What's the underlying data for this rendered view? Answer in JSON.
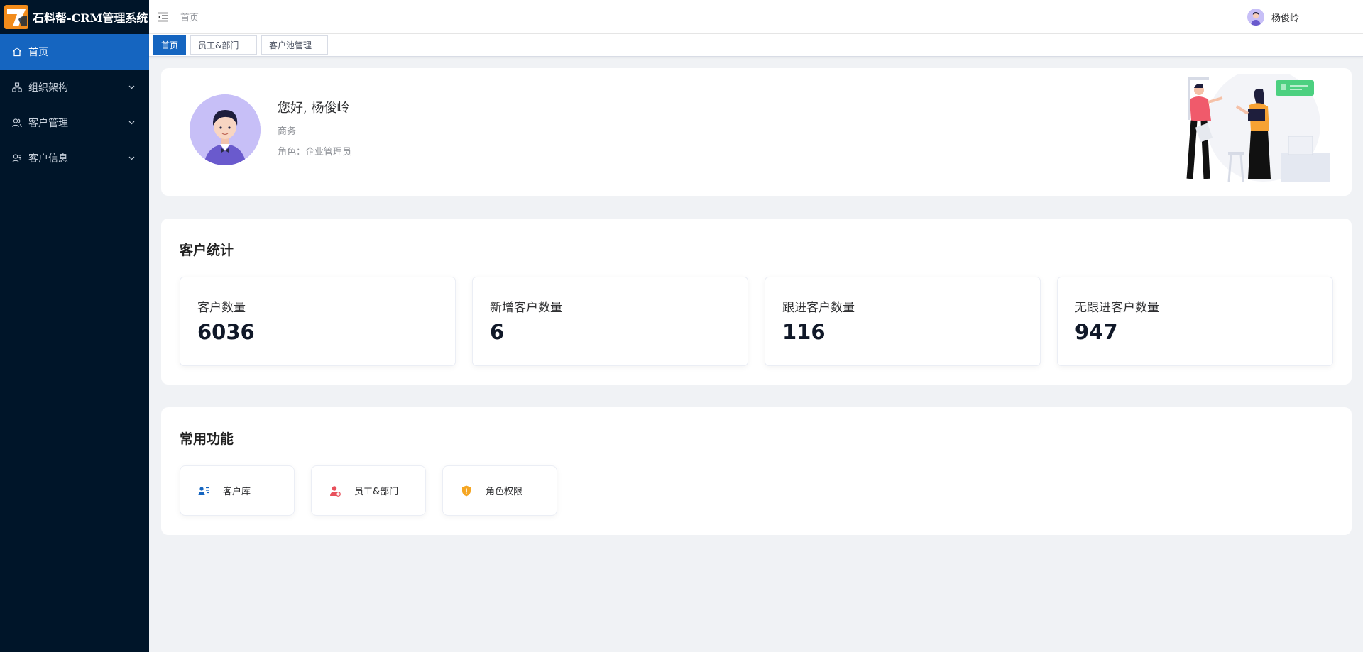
{
  "app": {
    "title": "石料帮-CRM管理系统"
  },
  "sidebar": {
    "items": [
      {
        "label": "首页",
        "icon": "home-icon",
        "active": true
      },
      {
        "label": "组织架构",
        "icon": "org-icon"
      },
      {
        "label": "客户管理",
        "icon": "users-icon"
      },
      {
        "label": "客户信息",
        "icon": "user-info-icon"
      }
    ]
  },
  "header": {
    "breadcrumb": "首页",
    "user_name": "杨俊岭"
  },
  "tabs": [
    {
      "label": "首页",
      "active": true
    },
    {
      "label": "员工&部门"
    },
    {
      "label": "客户池管理"
    }
  ],
  "welcome": {
    "greeting": "您好, 杨俊岭",
    "dept": "商务",
    "role": "角色：企业管理员"
  },
  "stats": {
    "title": "客户统计",
    "items": [
      {
        "label": "客户数量",
        "value": "6036"
      },
      {
        "label": "新增客户数量",
        "value": "6"
      },
      {
        "label": "跟进客户数量",
        "value": "116"
      },
      {
        "label": "无跟进客户数量",
        "value": "947"
      }
    ]
  },
  "functions": {
    "title": "常用功能",
    "items": [
      {
        "label": "客户库",
        "icon": "customer-library-icon",
        "color": "#1565c0"
      },
      {
        "label": "员工&部门",
        "icon": "employee-icon",
        "color": "#e8505b"
      },
      {
        "label": "角色权限",
        "icon": "shield-icon",
        "color": "#f5a623"
      }
    ]
  },
  "colors": {
    "sidebar_bg": "#001529",
    "accent": "#1565c0",
    "page_bg": "#f0f2f5"
  }
}
